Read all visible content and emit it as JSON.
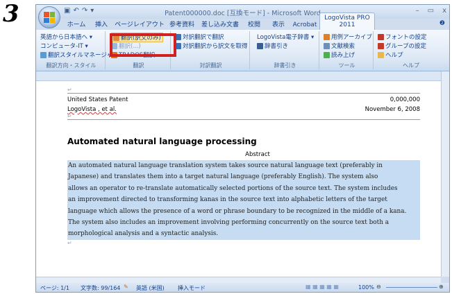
{
  "step_number": "3",
  "window": {
    "title": "Patent000000.doc [互換モード] - Microsoft Word",
    "controls": [
      "–",
      "▭",
      "x"
    ]
  },
  "ribbon_tabs": [
    "ホーム",
    "挿入",
    "ページレイアウト",
    "参考資料",
    "差し込み文書",
    "校閲",
    "表示",
    "Acrobat",
    "LogoVista PRO 2011"
  ],
  "active_tab": "LogoVista PRO 2011",
  "groups": {
    "direction": {
      "items": [
        "英語から日本語へ ▾",
        "コンピュータ-IT ▾",
        "翻訳スタイルマネージャ"
      ],
      "label": "翻訳方向・スタイル"
    },
    "translate": {
      "items": [
        "翻訳(訳文のみ)",
        "翻訳(...)",
        "TRADOS翻訳"
      ],
      "label": "翻訳"
    },
    "parallel": {
      "items": [
        "対訳翻訳で翻訳",
        "対訳翻訳から訳文を取得"
      ],
      "label": "対訳翻訳"
    },
    "dictionary": {
      "items": [
        "LogoVista電子辞書 ▾",
        "辞書引き"
      ],
      "label": "辞書引き"
    },
    "tools": {
      "items": [
        "用例アーカイブ",
        "文献検索",
        "読み上げ"
      ],
      "label": "ツール"
    },
    "help": {
      "items": [
        "フォントの設定",
        "グループの設定",
        "ヘルプ"
      ],
      "label": "ヘルプ"
    }
  },
  "document": {
    "patent_label": "United States Patent",
    "patent_number": "0,000,000",
    "author": "LogoVista , et al.",
    "date": "November 6, 2008",
    "title": "Automated natural language processing",
    "abstract_heading": "Abstract",
    "abstract_lines": [
      "An automated natural language translation system takes source natural language text (preferably in",
      "Japanese) and translates them into a target natural language (preferably English). The system also",
      "allows an operator to re-translate automatically selected portions of the source text. The system includes",
      "an improvement directed to transforming kanas in the source text into alphabetic letters of the target",
      "language which allows the presence of a word or phrase boundary to be recognized in the middle of a kana.",
      "The system also includes an improvement involving performing concurrently on the source text both a",
      "morphological analysis and a syntactic analysis."
    ]
  },
  "status": {
    "page": "ページ: 1/1",
    "words": "文字数: 99/164",
    "language": "英語 (米国)",
    "mode": "挿入モード",
    "zoom": "100%"
  },
  "colors": {
    "highlight_box": "#d02020",
    "selection": "#c5dcf2",
    "ribbon_text": "#15428b"
  }
}
